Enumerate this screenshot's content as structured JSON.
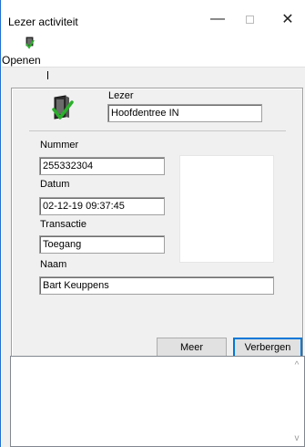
{
  "window": {
    "title": "Lezer activiteit",
    "minimize_glyph": "—",
    "close_glyph": "✕"
  },
  "toolbar": {
    "open_label": "Openen"
  },
  "reader": {
    "label": "Lezer",
    "value": "Hoofdentree IN"
  },
  "fields": {
    "nummer_label": "Nummer",
    "nummer_value": "255332304",
    "datum_label": "Datum",
    "datum_value": "02-12-19 09:37:45",
    "transactie_label": "Transactie",
    "transactie_value": "Toegang",
    "naam_label": "Naam",
    "naam_value": "Bart Keuppens"
  },
  "buttons": {
    "meer_label": "Meer",
    "verbergen_label": "Verbergen"
  },
  "log": {
    "scroll_up_glyph": "^",
    "scroll_down_glyph": "v"
  },
  "colors": {
    "window_border": "#1e6fd0",
    "client_bg": "#f0f0f0",
    "default_button_border": "#0078d7",
    "reader_icon_green": "#2bb02b"
  }
}
